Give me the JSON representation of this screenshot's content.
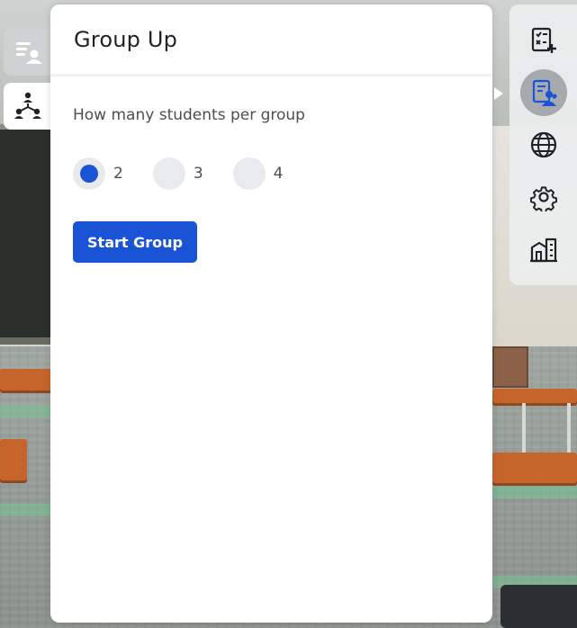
{
  "panel": {
    "title": "Group Up",
    "question": "How many students per group",
    "options": [
      {
        "label": "2",
        "selected": true
      },
      {
        "label": "3",
        "selected": false
      },
      {
        "label": "4",
        "selected": false
      }
    ],
    "start_button": "Start Group"
  },
  "left_tabs": [
    {
      "icon": "student-list-icon",
      "active": false
    },
    {
      "icon": "group-hierarchy-icon",
      "active": true
    }
  ],
  "toolbar": {
    "items": [
      {
        "icon": "quiz-add-icon",
        "active": false
      },
      {
        "icon": "student-roster-icon",
        "active": true
      },
      {
        "icon": "globe-icon",
        "active": false
      },
      {
        "icon": "settings-gear-icon",
        "active": false
      },
      {
        "icon": "buildings-icon",
        "active": false
      }
    ]
  },
  "colors": {
    "accent": "#1a53d6",
    "radio_bg": "#e9eaed",
    "panel_bg": "#ffffff",
    "toolbar_active": "#a7aaad"
  }
}
